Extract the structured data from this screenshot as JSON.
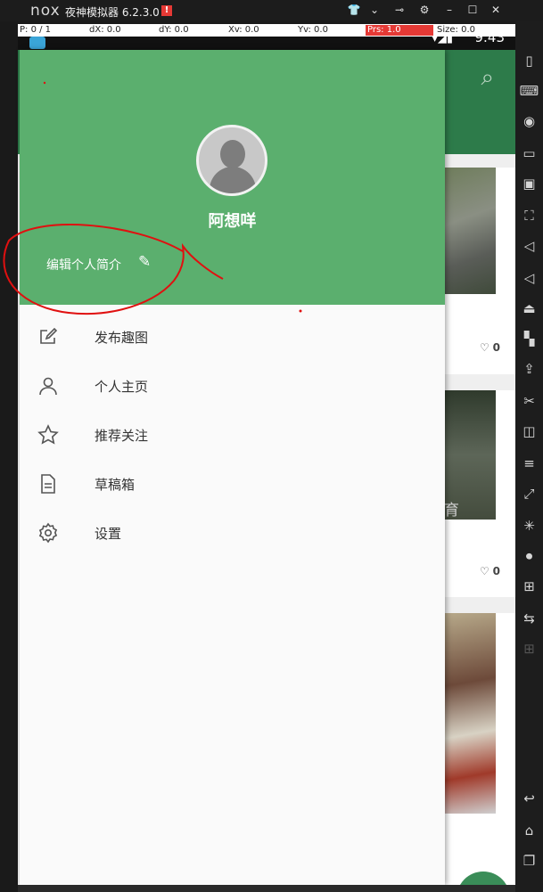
{
  "window": {
    "logo": "nox",
    "title": "夜神模拟器 6.2.3.0",
    "alert_icon": "!",
    "controls": [
      "shirt-icon",
      "chevron-down-icon",
      "pin-icon",
      "settings-icon",
      "minimize-icon",
      "maximize-icon",
      "close-icon"
    ]
  },
  "debug": {
    "p": "P: 0 / 1",
    "dx": "dX: 0.0",
    "dy": "dY: 0.0",
    "xv": "Xv: 0.0",
    "yv": "Yv: 0.0",
    "prs": "Prs: 1.0",
    "size": "Size: 0.0"
  },
  "status": {
    "time": "9:43"
  },
  "drawer": {
    "username": "阿想咩",
    "edit_bio": "编辑个人简介",
    "menu": [
      {
        "label": "发布趣图",
        "icon": "edit-square-icon"
      },
      {
        "label": "个人主页",
        "icon": "person-icon"
      },
      {
        "label": "推荐关注",
        "icon": "star-icon"
      },
      {
        "label": "草稿箱",
        "icon": "document-icon"
      },
      {
        "label": "设置",
        "icon": "settings-icon"
      }
    ]
  },
  "feed": {
    "likes": [
      "0",
      "0"
    ],
    "overlay_char": "育"
  },
  "colors": {
    "header_green": "#5baf6e",
    "toolbar_green": "#2d7b4a",
    "annotation_red": "#e01010"
  }
}
